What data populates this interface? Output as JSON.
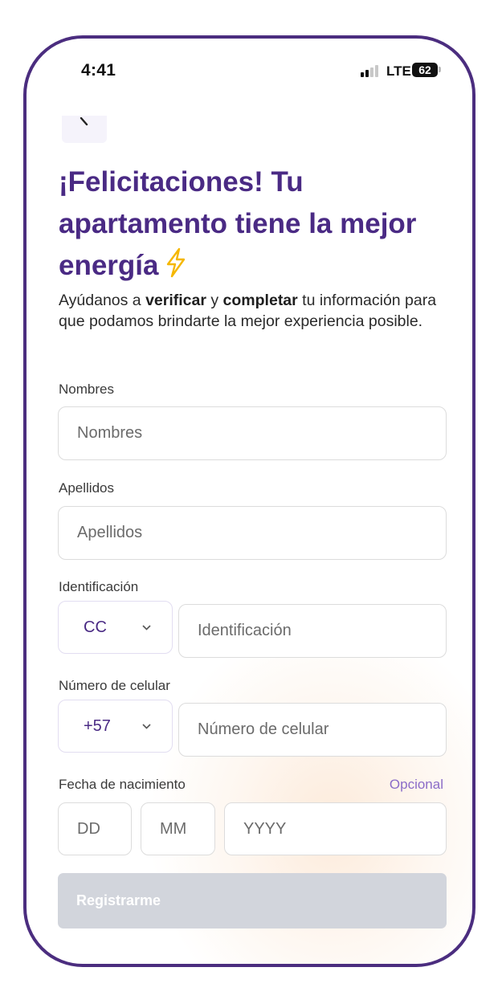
{
  "status_bar": {
    "time": "4:41",
    "network": "LTE",
    "battery": "62"
  },
  "header": {
    "back_icon": "chevron-left-icon",
    "title": "¡Felicitaciones! Tu apartamento tiene la mejor energía",
    "title_icon": "lightning-bolt-icon",
    "subtitle_parts": {
      "p1": "Ayúdanos a ",
      "b1": "verificar",
      "p2": " y ",
      "b2": "completar",
      "p3": " tu información para que podamos brindarte la mejor experiencia posible."
    }
  },
  "form": {
    "nombres": {
      "label": "Nombres",
      "placeholder": "Nombres"
    },
    "apellidos": {
      "label": "Apellidos",
      "placeholder": "Apellidos"
    },
    "identificacion": {
      "label": "Identificación",
      "type_value": "CC",
      "placeholder": "Identificación"
    },
    "celular": {
      "label": "Número de celular",
      "prefix_value": "+57",
      "placeholder": "Número de celular"
    },
    "nacimiento": {
      "label": "Fecha de nacimiento",
      "optional": "Opcional",
      "day_placeholder": "DD",
      "month_placeholder": "MM",
      "year_placeholder": "YYYY"
    },
    "submit_label": "Registrarme"
  },
  "colors": {
    "accent": "#4a2a84",
    "frame": "#4b2d7f",
    "optional": "#8a6cc8",
    "button_disabled": "#d2d5dc",
    "lightning": "#f5b700"
  }
}
